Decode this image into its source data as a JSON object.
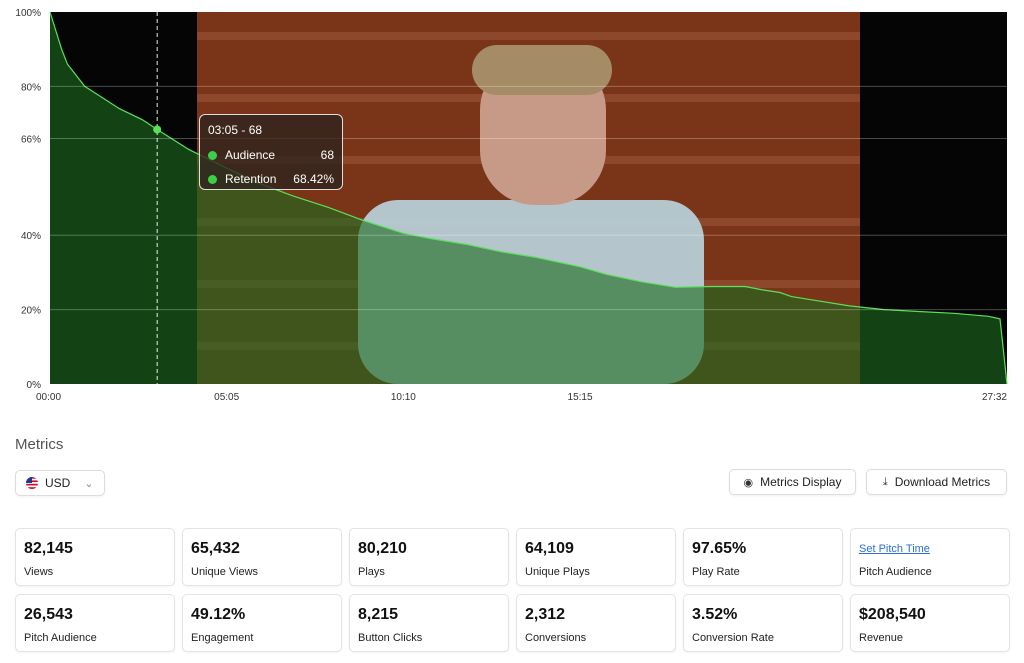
{
  "chart_data": {
    "type": "area",
    "x_unit": "mm:ss",
    "x_ticks": [
      "00:00",
      "05:05",
      "10:10",
      "15:15",
      "27:32"
    ],
    "y_ticks": [
      "100%",
      "80%",
      "66%",
      "40%",
      "20%",
      "0%"
    ],
    "ylim": [
      0,
      100
    ],
    "xlim": [
      "00:00",
      "27:32"
    ],
    "grid": true,
    "series": [
      {
        "x": [
          "00:00",
          "00:10",
          "00:20",
          "00:30",
          "00:45",
          "01:00",
          "01:20",
          "01:40",
          "02:00",
          "02:20",
          "02:40",
          "03:05",
          "04:00",
          "05:05",
          "06:00",
          "07:00",
          "08:00",
          "09:00",
          "10:10",
          "11:00",
          "12:00",
          "13:00",
          "14:00",
          "15:15",
          "16:00",
          "17:00",
          "18:00",
          "19:00",
          "20:00",
          "20:30",
          "21:00",
          "21:20",
          "22:00",
          "23:00",
          "24:00",
          "25:00",
          "26:00",
          "27:00",
          "27:20",
          "27:32"
        ],
        "values": [
          100,
          95,
          90,
          86,
          83,
          80,
          78,
          76,
          74,
          72.5,
          71,
          68.42,
          63,
          58,
          54,
          50.5,
          47.5,
          44,
          40.5,
          39,
          37.5,
          35.5,
          34,
          31.5,
          29.5,
          27.5,
          26,
          26.2,
          26.2,
          25.3,
          24.6,
          23.5,
          22.5,
          21,
          20,
          19.5,
          19,
          18.2,
          17.5,
          0
        ]
      }
    ],
    "colors": {
      "fill": "#1d6a1f",
      "line": "#5be05a",
      "point": "#5be05a"
    },
    "tooltip": {
      "title": "03:05 - 68",
      "rows": [
        {
          "label": "Audience",
          "value": "68"
        },
        {
          "label": "Retention",
          "value": "68.42%"
        }
      ]
    },
    "marker_x": "03:05"
  },
  "metrics": {
    "heading": "Metrics",
    "currency": {
      "value": "USD",
      "flag": "us-flag-icon"
    },
    "buttons": {
      "display": "Metrics Display",
      "download": "Download Metrics"
    },
    "cards": [
      {
        "value": "82,145",
        "label": "Views"
      },
      {
        "value": "65,432",
        "label": "Unique Views"
      },
      {
        "value": "80,210",
        "label": "Plays"
      },
      {
        "value": "64,109",
        "label": "Unique Plays"
      },
      {
        "value": "97.65%",
        "label": "Play Rate"
      },
      {
        "value": "Set Pitch Time",
        "label": "Pitch Audience",
        "link": true
      },
      {
        "value": "26,543",
        "label": "Pitch Audience"
      },
      {
        "value": "49.12%",
        "label": "Engagement"
      },
      {
        "value": "8,215",
        "label": "Button Clicks"
      },
      {
        "value": "2,312",
        "label": "Conversions"
      },
      {
        "value": "3.52%",
        "label": "Conversion Rate"
      },
      {
        "value": "$208,540",
        "label": "Revenue"
      }
    ]
  }
}
